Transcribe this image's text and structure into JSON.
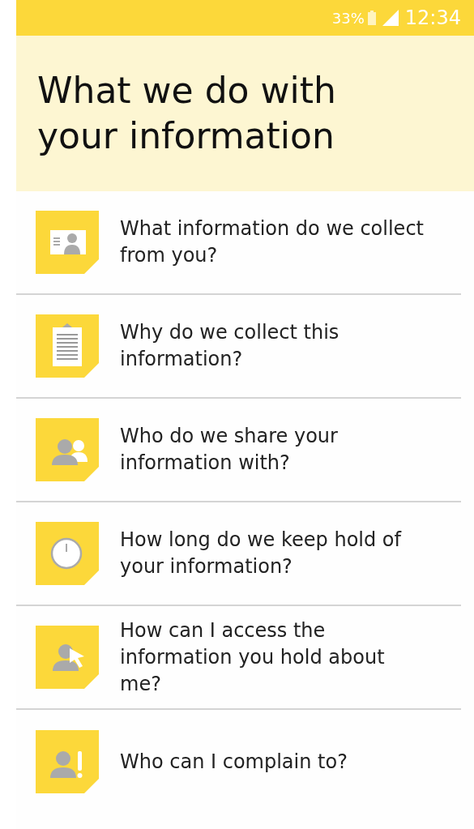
{
  "status_bar": {
    "battery": "33%",
    "time": "12:34"
  },
  "title": "What we do with your information",
  "items": [
    {
      "kind": "id-card",
      "label": "What information do we collect from you?"
    },
    {
      "kind": "clipboard",
      "label": "Why do we collect this information?"
    },
    {
      "kind": "people",
      "label": "Who do we share your information with?"
    },
    {
      "kind": "clock",
      "label": "How long do we keep hold of your information?"
    },
    {
      "kind": "cursor",
      "label": "How can I access the information you hold about me?"
    },
    {
      "kind": "alert",
      "label": "Who can I complain to?"
    }
  ]
}
